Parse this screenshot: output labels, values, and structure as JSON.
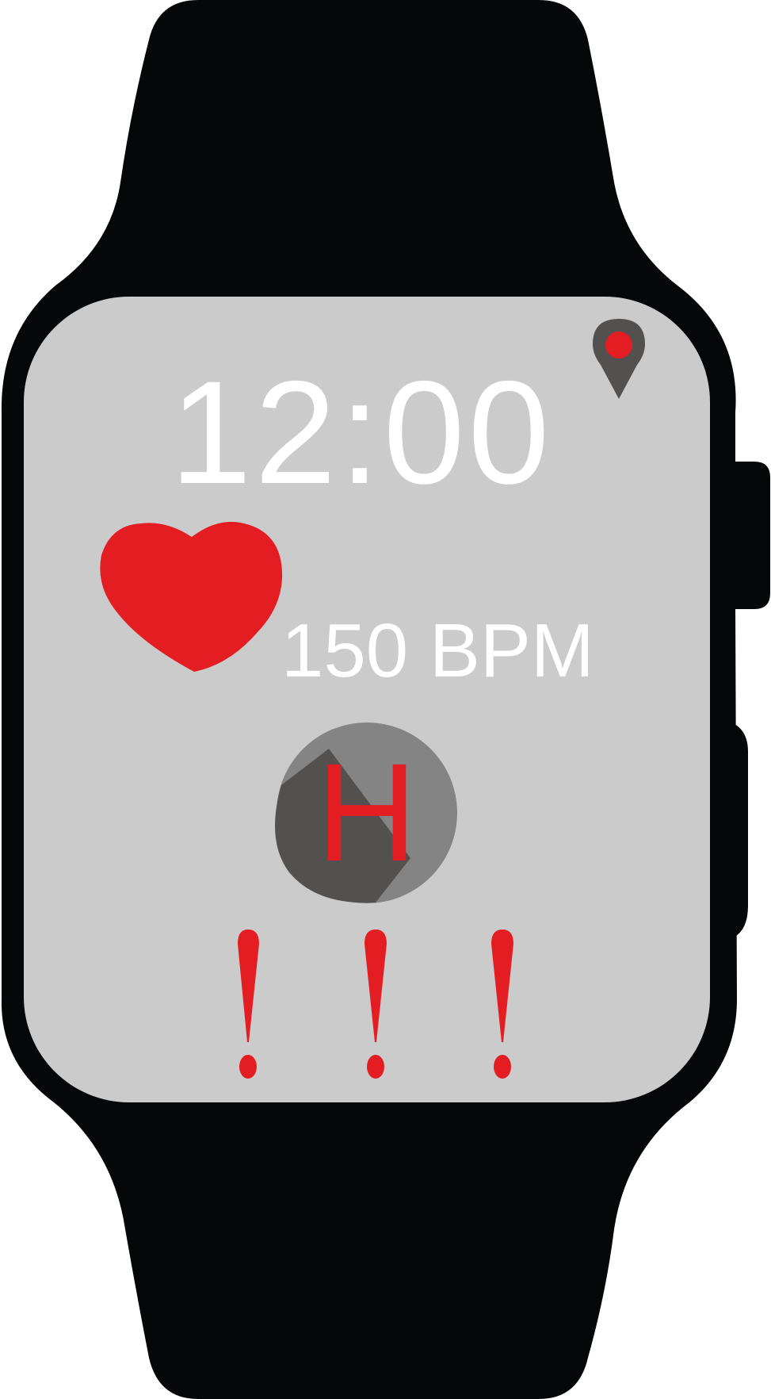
{
  "screen": {
    "time": "12:00",
    "heart_rate": "150 BPM",
    "hospital_symbol": "H"
  },
  "icons": {
    "location": "location-pin-icon",
    "heart": "heart-icon",
    "hospital": "hospital-icon",
    "alerts": [
      "exclamation-icon",
      "exclamation-icon",
      "exclamation-icon"
    ]
  },
  "colors": {
    "band": "#060709",
    "screen": "#cbcbcb",
    "accent_red": "#e41d23",
    "dark_gray": "#525150",
    "mid_gray": "#848484",
    "text": "#ffffff"
  }
}
